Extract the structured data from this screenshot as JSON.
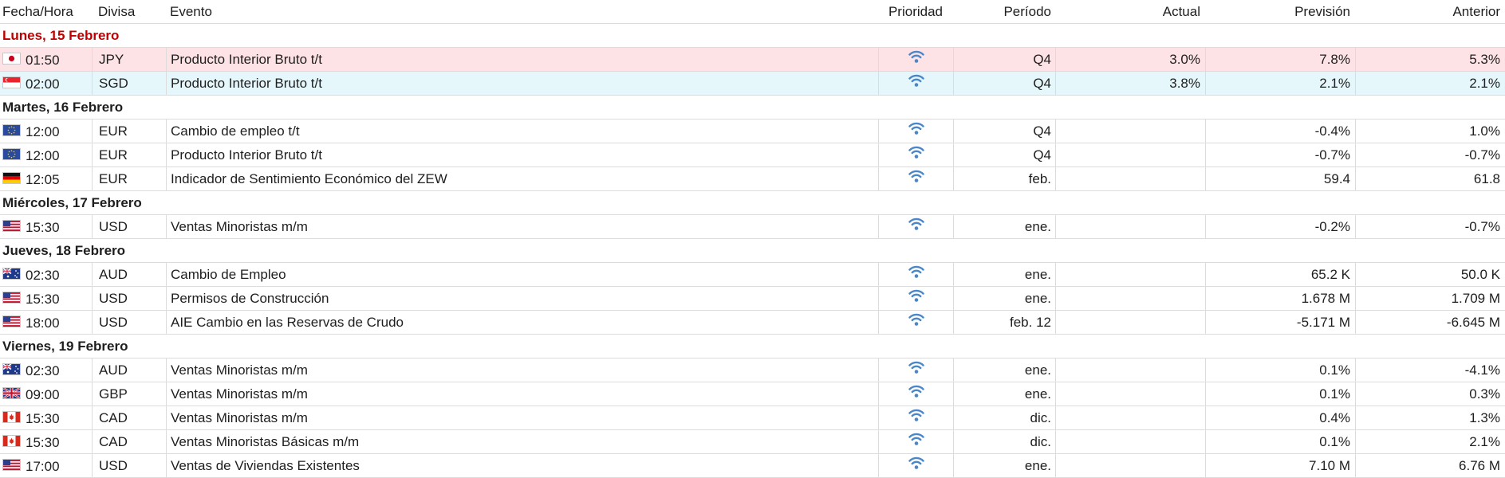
{
  "columns": {
    "time": "Fecha/Hora",
    "currency": "Divisa",
    "event": "Evento",
    "priority": "Prioridad",
    "period": "Período",
    "actual": "Actual",
    "forecast": "Previsión",
    "previous": "Anterior"
  },
  "colors": {
    "accent_red": "#c00000",
    "priority_icon": "#4a86c8",
    "row_red": "#fde3e6",
    "row_blue": "#e6f7fc"
  },
  "priority_icon": "wifi-signal-icon",
  "days": [
    {
      "label": "Lunes, 15 Febrero",
      "highlight": true,
      "events": [
        {
          "flag": "jp",
          "time": "01:50",
          "currency": "JPY",
          "event": "Producto Interior Bruto t/t",
          "period": "Q4",
          "actual": "3.0%",
          "forecast": "7.8%",
          "previous": "5.3%",
          "row": "red"
        },
        {
          "flag": "sg",
          "time": "02:00",
          "currency": "SGD",
          "event": "Producto Interior Bruto t/t",
          "period": "Q4",
          "actual": "3.8%",
          "forecast": "2.1%",
          "previous": "2.1%",
          "row": "blue"
        }
      ]
    },
    {
      "label": "Martes, 16 Febrero",
      "events": [
        {
          "flag": "eu",
          "time": "12:00",
          "currency": "EUR",
          "event": "Cambio de empleo t/t",
          "period": "Q4",
          "actual": "",
          "forecast": "-0.4%",
          "previous": "1.0%"
        },
        {
          "flag": "eu",
          "time": "12:00",
          "currency": "EUR",
          "event": "Producto Interior Bruto t/t",
          "period": "Q4",
          "actual": "",
          "forecast": "-0.7%",
          "previous": "-0.7%"
        },
        {
          "flag": "de",
          "time": "12:05",
          "currency": "EUR",
          "event": "Indicador de Sentimiento Económico del ZEW",
          "period": "feb.",
          "actual": "",
          "forecast": "59.4",
          "previous": "61.8"
        }
      ]
    },
    {
      "label": "Miércoles, 17 Febrero",
      "events": [
        {
          "flag": "us",
          "time": "15:30",
          "currency": "USD",
          "event": "Ventas Minoristas m/m",
          "period": "ene.",
          "actual": "",
          "forecast": "-0.2%",
          "previous": "-0.7%"
        }
      ]
    },
    {
      "label": "Jueves, 18 Febrero",
      "events": [
        {
          "flag": "au",
          "time": "02:30",
          "currency": "AUD",
          "event": "Cambio de Empleo",
          "period": "ene.",
          "actual": "",
          "forecast": "65.2 K",
          "previous": "50.0 K"
        },
        {
          "flag": "us",
          "time": "15:30",
          "currency": "USD",
          "event": "Permisos de Construcción",
          "period": "ene.",
          "actual": "",
          "forecast": "1.678 M",
          "previous": "1.709 M"
        },
        {
          "flag": "us",
          "time": "18:00",
          "currency": "USD",
          "event": "AIE Cambio en las Reservas de Crudo",
          "period": "feb. 12",
          "actual": "",
          "forecast": "-5.171 M",
          "previous": "-6.645 M"
        }
      ]
    },
    {
      "label": "Viernes, 19 Febrero",
      "events": [
        {
          "flag": "au",
          "time": "02:30",
          "currency": "AUD",
          "event": "Ventas Minoristas m/m",
          "period": "ene.",
          "actual": "",
          "forecast": "0.1%",
          "previous": "-4.1%"
        },
        {
          "flag": "gb",
          "time": "09:00",
          "currency": "GBP",
          "event": "Ventas Minoristas m/m",
          "period": "ene.",
          "actual": "",
          "forecast": "0.1%",
          "previous": "0.3%"
        },
        {
          "flag": "ca",
          "time": "15:30",
          "currency": "CAD",
          "event": "Ventas Minoristas m/m",
          "period": "dic.",
          "actual": "",
          "forecast": "0.4%",
          "previous": "1.3%"
        },
        {
          "flag": "ca",
          "time": "15:30",
          "currency": "CAD",
          "event": "Ventas Minoristas Básicas m/m",
          "period": "dic.",
          "actual": "",
          "forecast": "0.1%",
          "previous": "2.1%"
        },
        {
          "flag": "us",
          "time": "17:00",
          "currency": "USD",
          "event": "Ventas de Viviendas Existentes",
          "period": "ene.",
          "actual": "",
          "forecast": "7.10 M",
          "previous": "6.76 M"
        }
      ]
    }
  ]
}
